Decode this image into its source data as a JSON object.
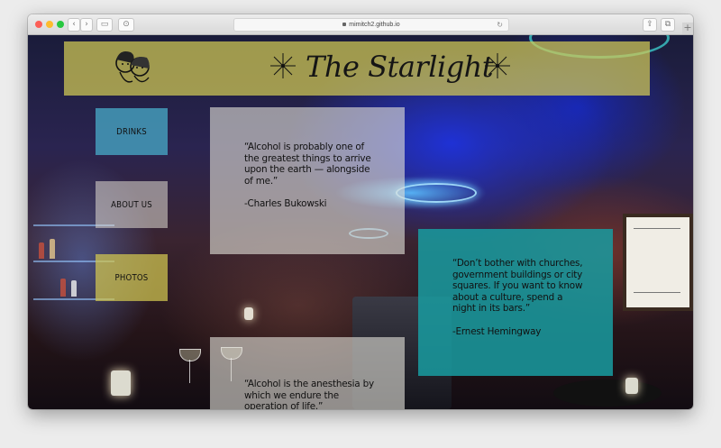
{
  "browser": {
    "url": "mimitch2.github.io",
    "back_glyph": "‹",
    "forward_glyph": "›",
    "sidebar_glyph": "▭",
    "share_glyph": "⇪",
    "tabs_glyph": "⧉",
    "reload_glyph": "↻",
    "new_tab_glyph": "+"
  },
  "header": {
    "logo_text": "The Starlight"
  },
  "nav": {
    "drinks": "DRINKS",
    "about": "ABOUT US",
    "photos": "PHOTOS"
  },
  "quotes": [
    {
      "text": "“Alcohol is probably one of the greatest things to arrive upon the earth — alongside of me.”",
      "author": "-Charles Bukowski"
    },
    {
      "text": "“Don’t bother with churches, government buildings or city squares. If you want to know about a culture, spend a night in its bars.”",
      "author": "-Ernest Hemingway"
    },
    {
      "text": "“Alcohol is the anesthesia by which we endure the operation of life.”",
      "author": ""
    }
  ],
  "colors": {
    "header_bg": "#d2ca54",
    "drinks_bg": "#46a0be",
    "photos_bg": "#d2c850",
    "teal_quote_bg": "#199ba0"
  }
}
